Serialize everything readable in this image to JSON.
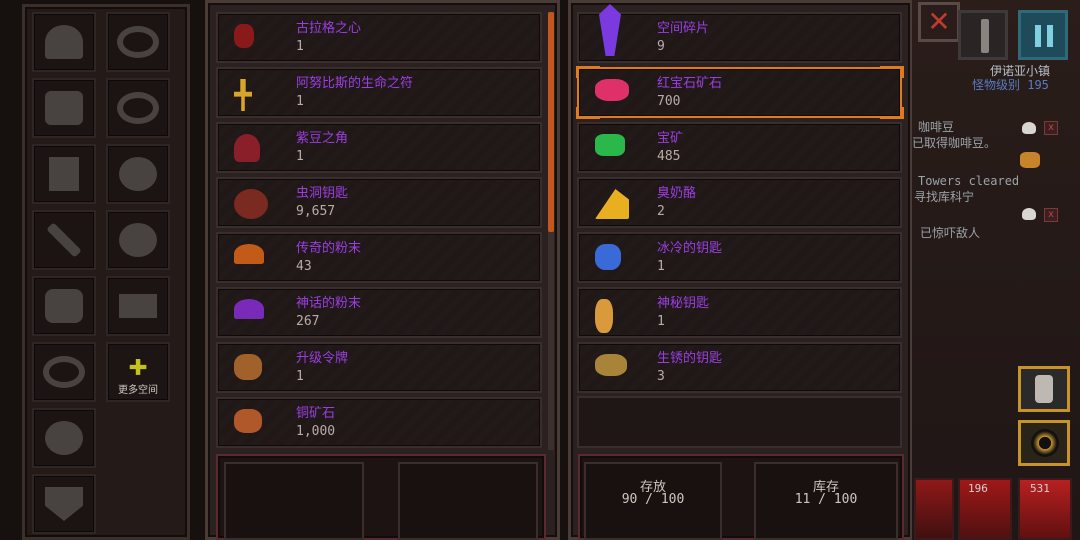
{
  "equipment": {
    "more_space_label": "更多空间"
  },
  "left_list": {
    "items": [
      {
        "name": "古拉格之心",
        "qty": "1",
        "icon": "heart-icon",
        "color": "#8a1a1a"
      },
      {
        "name": "阿努比斯的生命之符",
        "qty": "1",
        "icon": "ankh-icon",
        "color": "#d8a52a"
      },
      {
        "name": "紫豆之角",
        "qty": "1",
        "icon": "horn-icon",
        "color": "#8a1f2a"
      },
      {
        "name": "虫洞钥匙",
        "qty": "9,657",
        "icon": "wormhole-key-icon",
        "color": "#7a2a20"
      },
      {
        "name": "传奇的粉末",
        "qty": "43",
        "icon": "legendary-powder-icon",
        "color": "#c25a18"
      },
      {
        "name": "神话的粉末",
        "qty": "267",
        "icon": "mythic-powder-icon",
        "color": "#7a2ab8"
      },
      {
        "name": "升级令牌",
        "qty": "1",
        "icon": "upgrade-token-icon",
        "color": "#a0622a"
      },
      {
        "name": "铜矿石",
        "qty": "1,000",
        "icon": "copper-ore-icon",
        "color": "#b0582a"
      }
    ]
  },
  "right_list": {
    "items": [
      {
        "name": "空间碎片",
        "qty": "9",
        "icon": "space-shard-icon",
        "color": "#7a3ae0"
      },
      {
        "name": "红宝石矿石",
        "qty": "700",
        "icon": "ruby-ore-icon",
        "color": "#e0306a"
      },
      {
        "name": "宝矿",
        "qty": "485",
        "icon": "emerald-ore-icon",
        "color": "#2ab84a"
      },
      {
        "name": "臭奶酪",
        "qty": "2",
        "icon": "cheese-icon",
        "color": "#e8b020"
      },
      {
        "name": "冰冷的钥匙",
        "qty": "1",
        "icon": "ice-key-icon",
        "color": "#3a6ad8"
      },
      {
        "name": "神秘钥匙",
        "qty": "1",
        "icon": "mystic-key-icon",
        "color": "#d89a3a"
      },
      {
        "name": "生锈的钥匙",
        "qty": "3",
        "icon": "rusty-key-icon",
        "color": "#a8843a"
      }
    ],
    "selected_index": 1
  },
  "storage": {
    "stash_label": "存放",
    "stash_value": "90 / 100",
    "inventory_label": "库存",
    "inventory_value": "11 / 100"
  },
  "game": {
    "player_name": "伊诺亚小镇",
    "monster_level": "怪物级别 195",
    "quest1_a": "咖啡豆",
    "quest1_b": "已取得咖啡豆。",
    "quest2_a": "Towers cleared",
    "quest2_b": "寻找库科宁",
    "quest3": "已惊吓敌人",
    "count1": "196",
    "count2": "531"
  },
  "colors": {
    "item_name": "#9b3ee0",
    "accent": "#e07a1e",
    "scroll_thumb": "#c4571d"
  }
}
